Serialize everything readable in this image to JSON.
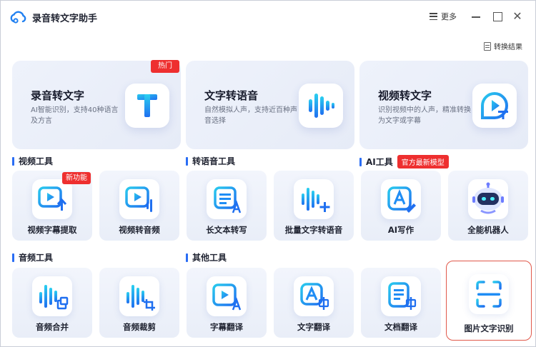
{
  "window": {
    "title": "录音转文字助手",
    "more_label": "更多",
    "close_glyph": "✕"
  },
  "toolbar": {
    "result_label": "转换结果"
  },
  "features": [
    {
      "title": "录音转文字",
      "desc": "AI智能识别，支持40种语言及方言",
      "badge": "热门",
      "icon": "letter-t-icon"
    },
    {
      "title": "文字转语音",
      "desc": "自然模拟人声，支持近百种声音选择",
      "icon": "sound-wave-icon"
    },
    {
      "title": "视频转文字",
      "desc": "识别视频中的人声，精准转换为文字或字幕",
      "icon": "video-text-icon"
    }
  ],
  "sections": {
    "video": "视频工具",
    "speech": "转语音工具",
    "ai": "AI工具",
    "ai_tag": "官方最新模型",
    "audio": "音频工具",
    "other": "其他工具"
  },
  "tools": {
    "row1": [
      {
        "label": "视频字幕提取",
        "badge": "新功能",
        "icon": "video-subtitle-icon"
      },
      {
        "label": "视频转音频",
        "icon": "video-audio-icon"
      },
      {
        "label": "长文本转写",
        "icon": "long-text-icon"
      },
      {
        "label": "批量文字转语音",
        "icon": "batch-tts-icon"
      },
      {
        "label": "AI写作",
        "icon": "ai-writing-icon"
      },
      {
        "label": "全能机器人",
        "icon": "robot-icon"
      }
    ],
    "row2": [
      {
        "label": "音频合并",
        "icon": "audio-merge-icon"
      },
      {
        "label": "音频裁剪",
        "icon": "audio-cut-icon"
      },
      {
        "label": "字幕翻译",
        "icon": "subtitle-translate-icon"
      },
      {
        "label": "文字翻译",
        "icon": "text-translate-icon"
      },
      {
        "label": "文档翻译",
        "icon": "doc-translate-icon"
      },
      {
        "label": "图片文字识别",
        "icon": "image-ocr-icon",
        "selected": true
      }
    ]
  },
  "colors": {
    "accent": "#2a6df4",
    "badge": "#ee2f2f",
    "selected_border": "#e0584a",
    "icon_blue": "#1f8df5",
    "icon_cyan": "#1fc8e8"
  }
}
